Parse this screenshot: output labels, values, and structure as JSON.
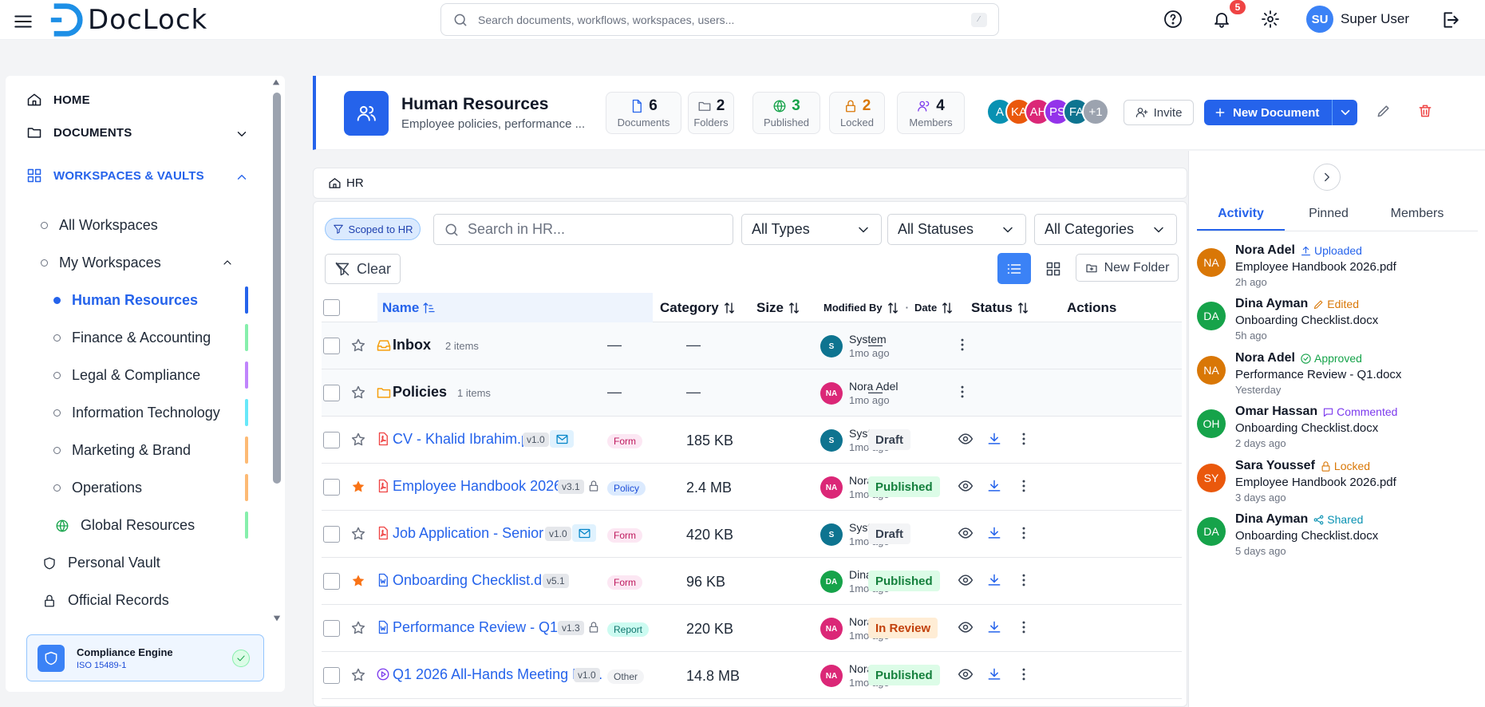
{
  "app": {
    "name": "DocLock"
  },
  "search": {
    "placeholder": "Search documents, workflows, workspaces, users...",
    "kbd": "⁄"
  },
  "notifications": {
    "count": "5"
  },
  "user": {
    "initials": "SU",
    "name": "Super User"
  },
  "sidebar": {
    "home": "HOME",
    "documents": "DOCUMENTS",
    "workspaces": "WORKSPACES & VAULTS",
    "all_workspaces": "All Workspaces",
    "my_workspaces": "My Workspaces",
    "items": [
      {
        "label": "Human Resources",
        "color": "#2563eb"
      },
      {
        "label": "Finance & Accounting",
        "color": "#86efac"
      },
      {
        "label": "Legal & Compliance",
        "color": "#c084fc"
      },
      {
        "label": "Information Technology",
        "color": "#67e8f9"
      },
      {
        "label": "Marketing & Brand",
        "color": "#fdba74"
      },
      {
        "label": "Operations",
        "color": "#fdba74"
      },
      {
        "label": "Global Resources",
        "color": "#86efac"
      }
    ],
    "personal_vault": "Personal Vault",
    "official_records": "Official Records",
    "compliance": {
      "title": "Compliance Engine",
      "sub": "ISO 15489-1"
    }
  },
  "workspace": {
    "title": "Human Resources",
    "desc": "Employee policies, performance ...",
    "stats": [
      {
        "value": "6",
        "label": "Documents",
        "color": "#2563eb"
      },
      {
        "value": "2",
        "label": "Folders",
        "color": "#6b7280"
      },
      {
        "value": "3",
        "label": "Published",
        "color": "#16a34a"
      },
      {
        "value": "2",
        "label": "Locked",
        "color": "#d97706"
      },
      {
        "value": "4",
        "label": "Members",
        "color": "#7c3aed"
      }
    ],
    "members": [
      {
        "initials": "A",
        "color": "#0891b2"
      },
      {
        "initials": "KA",
        "color": "#ea580c"
      },
      {
        "initials": "AH",
        "color": "#db2777"
      },
      {
        "initials": "PS",
        "color": "#9333ea"
      },
      {
        "initials": "FA",
        "color": "#0e7490"
      },
      {
        "initials": "+1",
        "color": "#9ca3af"
      }
    ],
    "invite": "Invite",
    "new_document": "New Document"
  },
  "breadcrumb": "HR",
  "filters": {
    "scoped": "Scoped to HR",
    "search_placeholder": "Search in HR...",
    "types": "All Types",
    "statuses": "All Statuses",
    "categories": "All Categories",
    "clear": "Clear",
    "new_folder": "New Folder"
  },
  "table": {
    "headers": {
      "name": "Name",
      "category": "Category",
      "size": "Size",
      "modified_by": "Modified By",
      "date": "Date",
      "status": "Status",
      "actions": "Actions"
    },
    "rows": [
      {
        "kind": "folder",
        "name": "Inbox",
        "meta": "2 items",
        "category": "—",
        "size": "—",
        "by": "System",
        "by_initials": "S",
        "by_color": "#0e7490",
        "date": "1mo ago",
        "status": "—"
      },
      {
        "kind": "folder",
        "name": "Policies",
        "meta": "1 items",
        "category": "—",
        "size": "—",
        "by": "Nora Adel",
        "by_initials": "NA",
        "by_color": "#db2777",
        "date": "1mo ago",
        "status": "—"
      },
      {
        "kind": "pdf",
        "name": "CV - Khalid Ibrahim.pdf",
        "version": "v1.0",
        "mail": true,
        "category": "Form",
        "size": "185 KB",
        "by": "System",
        "by_initials": "S",
        "by_color": "#0e7490",
        "date": "1mo ago",
        "status": "Draft",
        "starred": false
      },
      {
        "kind": "pdf",
        "name": "Employee Handbook 2026....",
        "version": "v3.1",
        "lock": true,
        "category": "Policy",
        "size": "2.4 MB",
        "by": "Nora Adel",
        "by_initials": "NA",
        "by_color": "#db2777",
        "date": "1mo ago",
        "status": "Published",
        "starred": true
      },
      {
        "kind": "pdf",
        "name": "Job Application - Senior ...",
        "version": "v1.0",
        "mail": true,
        "category": "Form",
        "size": "420 KB",
        "by": "System",
        "by_initials": "S",
        "by_color": "#0e7490",
        "date": "1mo ago",
        "status": "Draft",
        "starred": false
      },
      {
        "kind": "word",
        "name": "Onboarding Checklist.docx",
        "version": "v5.1",
        "category": "Form",
        "size": "96 KB",
        "by": "Dina Ayman",
        "by_initials": "DA",
        "by_color": "#16a34a",
        "date": "1mo ago",
        "status": "Published",
        "starred": true
      },
      {
        "kind": "word",
        "name": "Performance Review - Q1.d...",
        "version": "v1.3",
        "lock": true,
        "category": "Report",
        "size": "220 KB",
        "by": "Nora Adel",
        "by_initials": "NA",
        "by_color": "#db2777",
        "date": "1mo ago",
        "status": "In Review",
        "starred": false
      },
      {
        "kind": "video",
        "name": "Q1 2026 All-Hands Meeting Re...",
        "version": "v1.0",
        "category": "Other",
        "size": "14.8 MB",
        "by": "Nora Adel",
        "by_initials": "NA",
        "by_color": "#db2777",
        "date": "1mo ago",
        "status": "Published",
        "starred": false
      }
    ]
  },
  "panel": {
    "tabs": [
      "Activity",
      "Pinned",
      "Members"
    ],
    "feed": [
      {
        "initials": "NA",
        "color": "#d97706",
        "user": "Nora Adel",
        "action": "Uploaded",
        "action_color": "#2563eb",
        "file": "Employee Handbook 2026.pdf",
        "time": "2h ago"
      },
      {
        "initials": "DA",
        "color": "#16a34a",
        "user": "Dina Ayman",
        "action": "Edited",
        "action_color": "#d97706",
        "file": "Onboarding Checklist.docx",
        "time": "5h ago"
      },
      {
        "initials": "NA",
        "color": "#d97706",
        "user": "Nora Adel",
        "action": "Approved",
        "action_color": "#16a34a",
        "file": "Performance Review - Q1.docx",
        "time": "Yesterday"
      },
      {
        "initials": "OH",
        "color": "#16a34a",
        "user": "Omar Hassan",
        "action": "Commented",
        "action_color": "#7c3aed",
        "file": "Onboarding Checklist.docx",
        "time": "2 days ago"
      },
      {
        "initials": "SY",
        "color": "#ea580c",
        "user": "Sara Youssef",
        "action": "Locked",
        "action_color": "#d97706",
        "file": "Employee Handbook 2026.pdf",
        "time": "3 days ago"
      },
      {
        "initials": "DA",
        "color": "#16a34a",
        "user": "Dina Ayman",
        "action": "Shared",
        "action_color": "#0891b2",
        "file": "Onboarding Checklist.docx",
        "time": "5 days ago"
      }
    ]
  }
}
